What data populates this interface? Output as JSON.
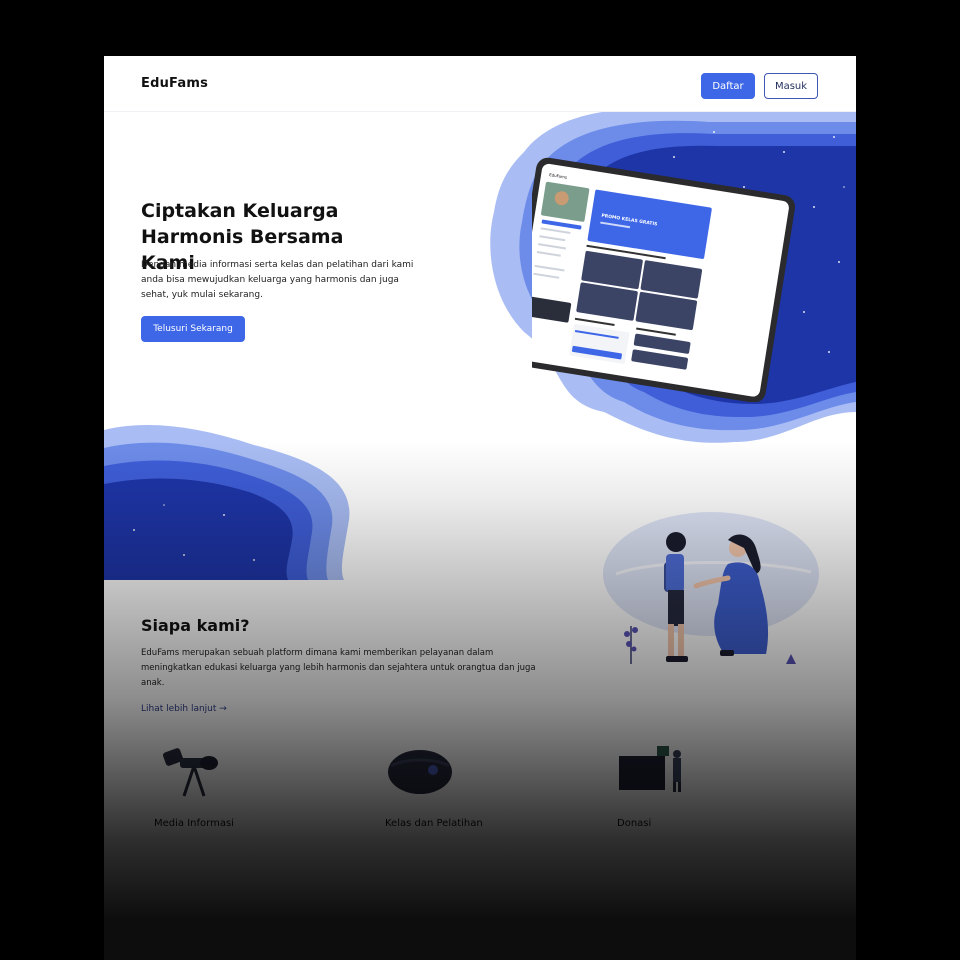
{
  "navbar": {
    "logo": "EduFams",
    "register_label": "Daftar",
    "login_label": "Masuk"
  },
  "hero": {
    "title_line1": "Ciptakan Keluarga",
    "title_line2": "Harmonis Bersama Kami",
    "description": "Dengan media informasi serta kelas dan pelatihan dari kami anda bisa mewujudkan keluarga yang harmonis dan juga sehat, yuk mulai sekarang.",
    "cta_label": "Telusuri Sekarang"
  },
  "tablet_preview": {
    "app_name": "EduFams",
    "promo_title": "PROMO KELAS GRATIS"
  },
  "about": {
    "title": "Siapa kami?",
    "description": "EduFams merupakan sebuah platform dimana kami memberikan pelayanan dalam meningkatkan edukasi keluarga yang lebih harmonis dan sejahtera untuk orangtua dan juga anak.",
    "link_label": "Lihat lebih lanjut →"
  },
  "features": [
    {
      "title": "Media Informasi",
      "icon": "telescope-icon"
    },
    {
      "title": "Kelas dan Pelatihan",
      "icon": "vr-headset-icon"
    },
    {
      "title": "Donasi",
      "icon": "donation-box-icon"
    }
  ],
  "colors": {
    "primary": "#3e67e8",
    "deep_blue": "#1e3bb0",
    "mid_blue": "#4f74e3",
    "light_blue": "#8aa4ef"
  }
}
